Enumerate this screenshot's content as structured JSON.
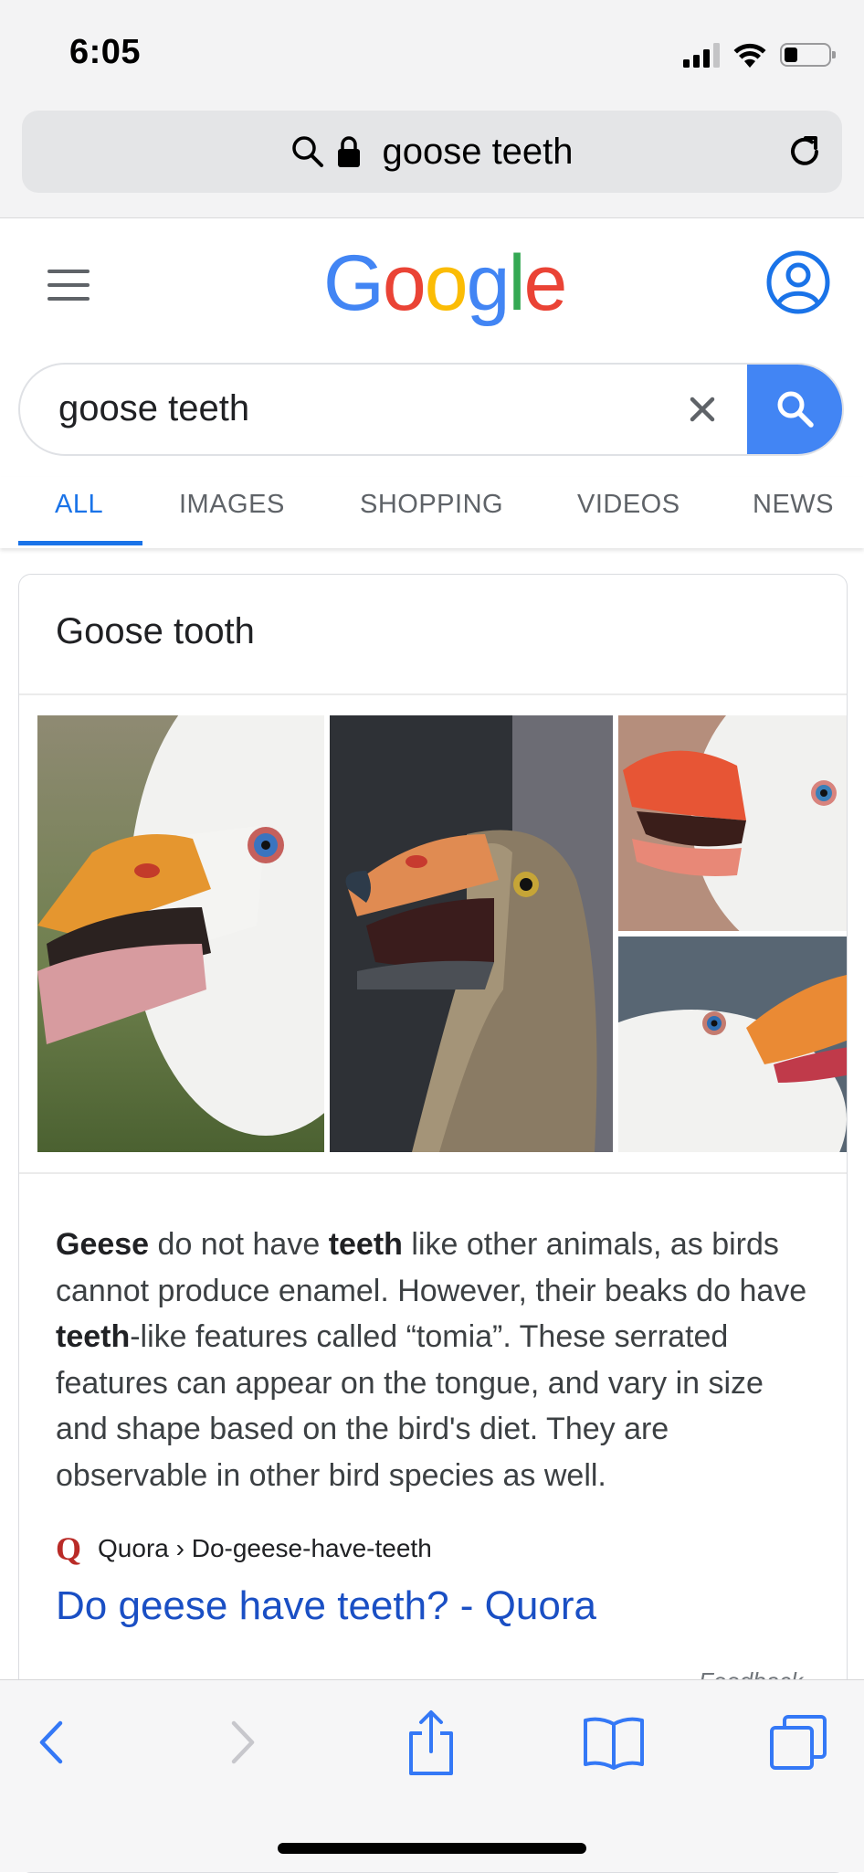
{
  "status_bar": {
    "time": "6:05"
  },
  "address_bar": {
    "url_text": "goose teeth"
  },
  "google": {
    "logo_letters": [
      "G",
      "o",
      "o",
      "g",
      "l",
      "e"
    ],
    "logo_colors": [
      "#4285f4",
      "#ea4335",
      "#fbbc05",
      "#4285f4",
      "#34a853",
      "#ea4335"
    ],
    "search_value": "goose teeth"
  },
  "tabs": [
    {
      "label": "ALL",
      "active": true
    },
    {
      "label": "IMAGES",
      "active": false
    },
    {
      "label": "SHOPPING",
      "active": false
    },
    {
      "label": "VIDEOS",
      "active": false
    },
    {
      "label": "NEWS",
      "active": false
    }
  ],
  "featured": {
    "title": "Goose tooth",
    "answer": [
      {
        "text": "Geese",
        "bold": true
      },
      {
        "text": " do not have ",
        "bold": false
      },
      {
        "text": "teeth",
        "bold": true
      },
      {
        "text": " like other animals, as birds cannot produce enamel. However, their beaks do have ",
        "bold": false
      },
      {
        "text": "teeth",
        "bold": true
      },
      {
        "text": "-like features called “tomia”. These serrated features can appear on the tongue, and vary in size and shape based on the bird's diet. They are observable in other bird species as well.",
        "bold": false
      }
    ],
    "source_breadcrumb": "Quora › Do-geese-have-teeth",
    "source_letter": "Q",
    "result_title": "Do geese have teeth? - Quora",
    "feedback": "Feedback"
  },
  "toolbar": {
    "icons": [
      "back-icon",
      "forward-icon",
      "share-icon",
      "bookmarks-icon",
      "tabs-icon"
    ]
  },
  "colors": {
    "accent_blue": "#4285f4",
    "link_blue": "#1a4fc4",
    "safari_blue": "#3478f6",
    "quora_red": "#b92b27"
  }
}
